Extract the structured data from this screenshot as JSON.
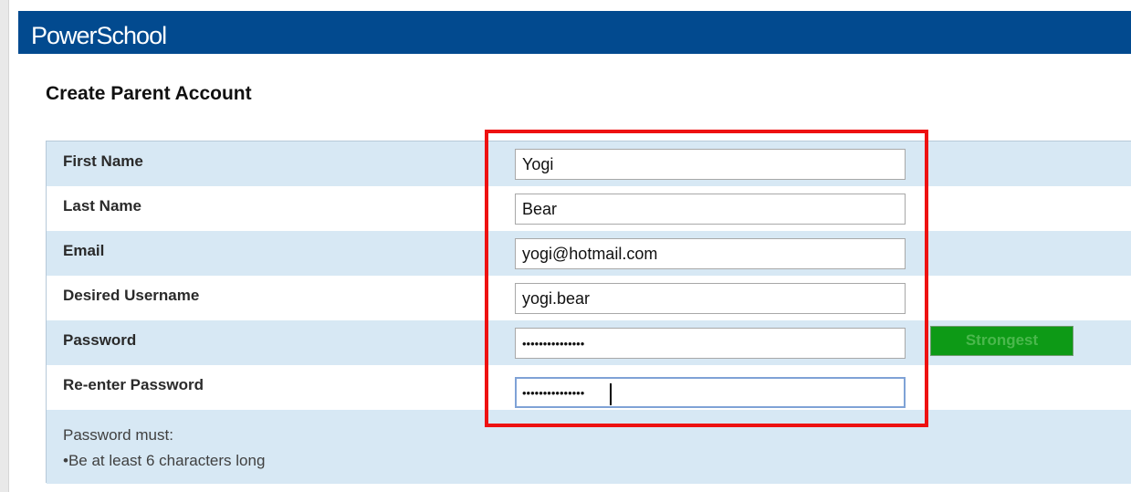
{
  "brand": {
    "logo_text": "PowerSchool",
    "banner_color": "#024a8f"
  },
  "page": {
    "title": "Create Parent Account"
  },
  "form": {
    "fields": [
      {
        "label": "First Name",
        "value": "Yogi",
        "type": "text"
      },
      {
        "label": "Last Name",
        "value": "Bear",
        "type": "text"
      },
      {
        "label": "Email",
        "value": "yogi@hotmail.com",
        "type": "text"
      },
      {
        "label": "Desired Username",
        "value": "yogi.bear",
        "type": "text"
      },
      {
        "label": "Password",
        "value": "•••••••••••••••",
        "type": "password"
      },
      {
        "label": "Re-enter Password",
        "value": "•••••••••••••••",
        "type": "password",
        "focused": true
      }
    ],
    "password_strength": {
      "label": "Strongest",
      "color": "#0d9a16"
    },
    "help": {
      "heading": "Password must:",
      "rules": [
        "•Be at least 6 characters long"
      ]
    }
  },
  "annotation": {
    "highlight_color": "#ee1111"
  }
}
